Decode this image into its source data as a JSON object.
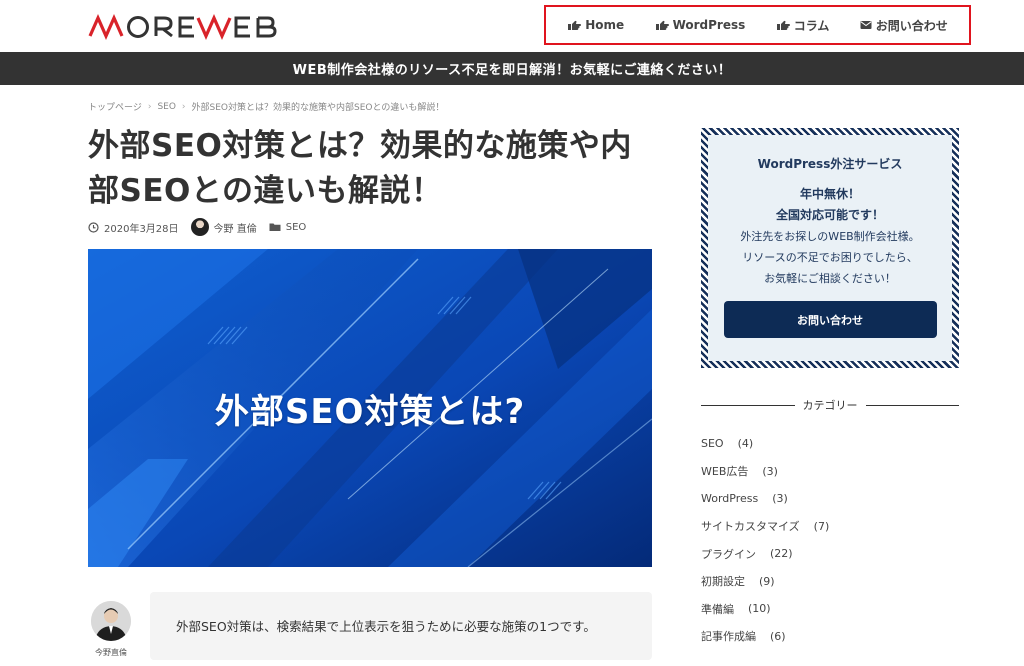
{
  "header": {
    "logo_text": "MOREWEB",
    "nav": [
      {
        "label": "Home",
        "icon": "pointing-hand-icon"
      },
      {
        "label": "WordPress",
        "icon": "pointing-hand-icon"
      },
      {
        "label": "コラム",
        "icon": "pointing-hand-icon"
      },
      {
        "label": "お問い合わせ",
        "icon": "envelope-icon"
      }
    ]
  },
  "announcement": "WEB制作会社様のリソース不足を即日解消！お気軽にご連絡ください！",
  "breadcrumb": [
    "トップページ",
    "SEO",
    "外部SEO対策とは？効果的な施策や内部SEOとの違いも解説！"
  ],
  "breadcrumb_sep": "›",
  "article": {
    "title_line1": "外部SEO対策とは？効果的な施策や内",
    "title_line2": "部SEOとの違いも解説！",
    "date": "2020年3月28日",
    "author": "今野 直倫",
    "category": "SEO",
    "hero_text": "外部SEO対策とは?",
    "speaker_name": "今野直倫",
    "speech": "外部SEO対策は、検索結果で上位表示を狙うために必要な施策の1つです。"
  },
  "sidebar": {
    "promo": {
      "title": "WordPress外注サービス",
      "line1": "年中無休！",
      "line2": "全国対応可能です！",
      "body1": "外注先をお探しのWEB制作会社様。",
      "body2": "リソースの不足でお困りでしたら、",
      "body3": "お気軽にご相談ください！",
      "button": "お問い合わせ"
    },
    "categories_heading": "カテゴリー",
    "categories": [
      {
        "name": "SEO",
        "count": "(4)"
      },
      {
        "name": "WEB広告",
        "count": "(3)"
      },
      {
        "name": "WordPress",
        "count": "(3)"
      },
      {
        "name": "サイトカスタマイズ",
        "count": "(7)"
      },
      {
        "name": "プラグイン",
        "count": "(22)"
      },
      {
        "name": "初期設定",
        "count": "(9)"
      },
      {
        "name": "準備編",
        "count": "(10)"
      },
      {
        "name": "記事作成編",
        "count": "(6)"
      }
    ]
  },
  "colors": {
    "logo_red": "#d9232a",
    "logo_dark": "#333333",
    "nav_highlight": "#e0141e",
    "bar": "#333333",
    "hero_blue": "#063a9a",
    "promo_navy": "#0d2b55"
  }
}
